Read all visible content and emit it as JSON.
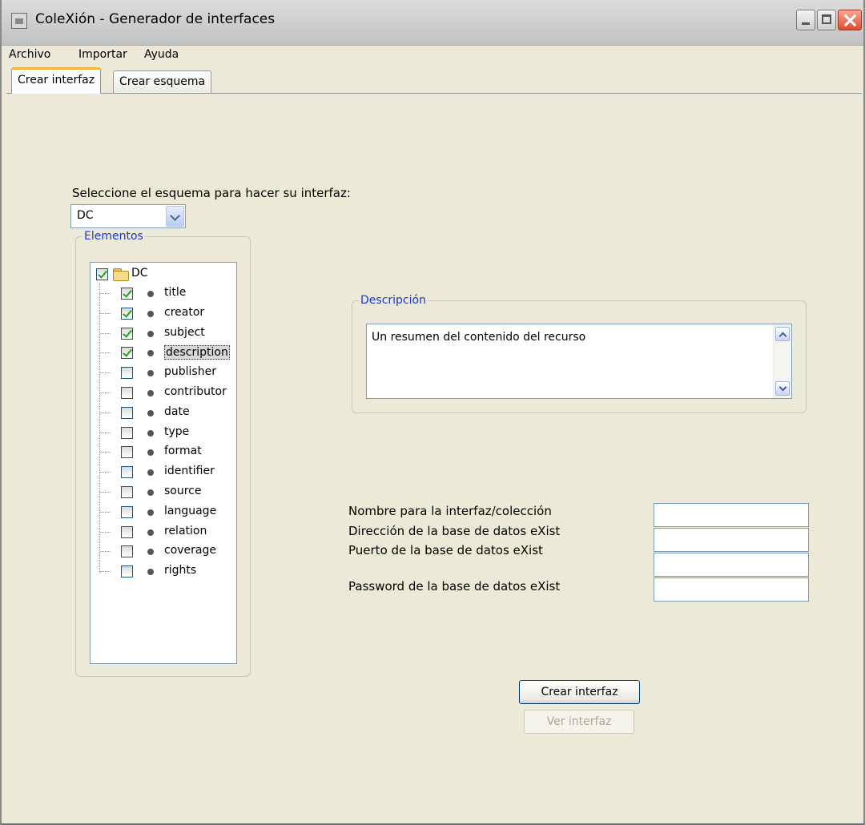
{
  "window": {
    "title": "ColeXión - Generador de interfaces",
    "controls": [
      "minimize",
      "maximize",
      "close"
    ]
  },
  "menubar": {
    "items": [
      "Archivo",
      "Importar",
      "Ayuda"
    ]
  },
  "tabs": [
    {
      "label": "Crear interfaz",
      "active": true
    },
    {
      "label": "Crear esquema",
      "active": false
    }
  ],
  "schema_select": {
    "label": "Seleccione el esquema para hacer su interfaz:",
    "value": "DC"
  },
  "elements_group": {
    "legend": "Elementos",
    "root": {
      "label": "DC",
      "checked": true
    },
    "items": [
      {
        "label": "title",
        "checked": true
      },
      {
        "label": "creator",
        "checked": true
      },
      {
        "label": "subject",
        "checked": true
      },
      {
        "label": "description",
        "checked": true,
        "selected": true
      },
      {
        "label": "publisher",
        "checked": false
      },
      {
        "label": "contributor",
        "checked": false
      },
      {
        "label": "date",
        "checked": false
      },
      {
        "label": "type",
        "checked": false
      },
      {
        "label": "format",
        "checked": false
      },
      {
        "label": "identifier",
        "checked": false
      },
      {
        "label": "source",
        "checked": false
      },
      {
        "label": "language",
        "checked": false
      },
      {
        "label": "relation",
        "checked": false
      },
      {
        "label": "coverage",
        "checked": false
      },
      {
        "label": "rights",
        "checked": false
      }
    ]
  },
  "description_group": {
    "legend": "Descripción",
    "text": "Un resumen del contenido del recurso"
  },
  "form": {
    "fields": [
      {
        "label": "Nombre para la interfaz/colección",
        "value": ""
      },
      {
        "label": "Dirección de la base de datos eXist",
        "value": ""
      },
      {
        "label": "Puerto de la base de datos eXist",
        "value": ""
      },
      {
        "label": "Password de la base de datos eXist",
        "value": ""
      }
    ]
  },
  "buttons": {
    "create": "Crear interfaz",
    "view": "Ver interfaz"
  }
}
